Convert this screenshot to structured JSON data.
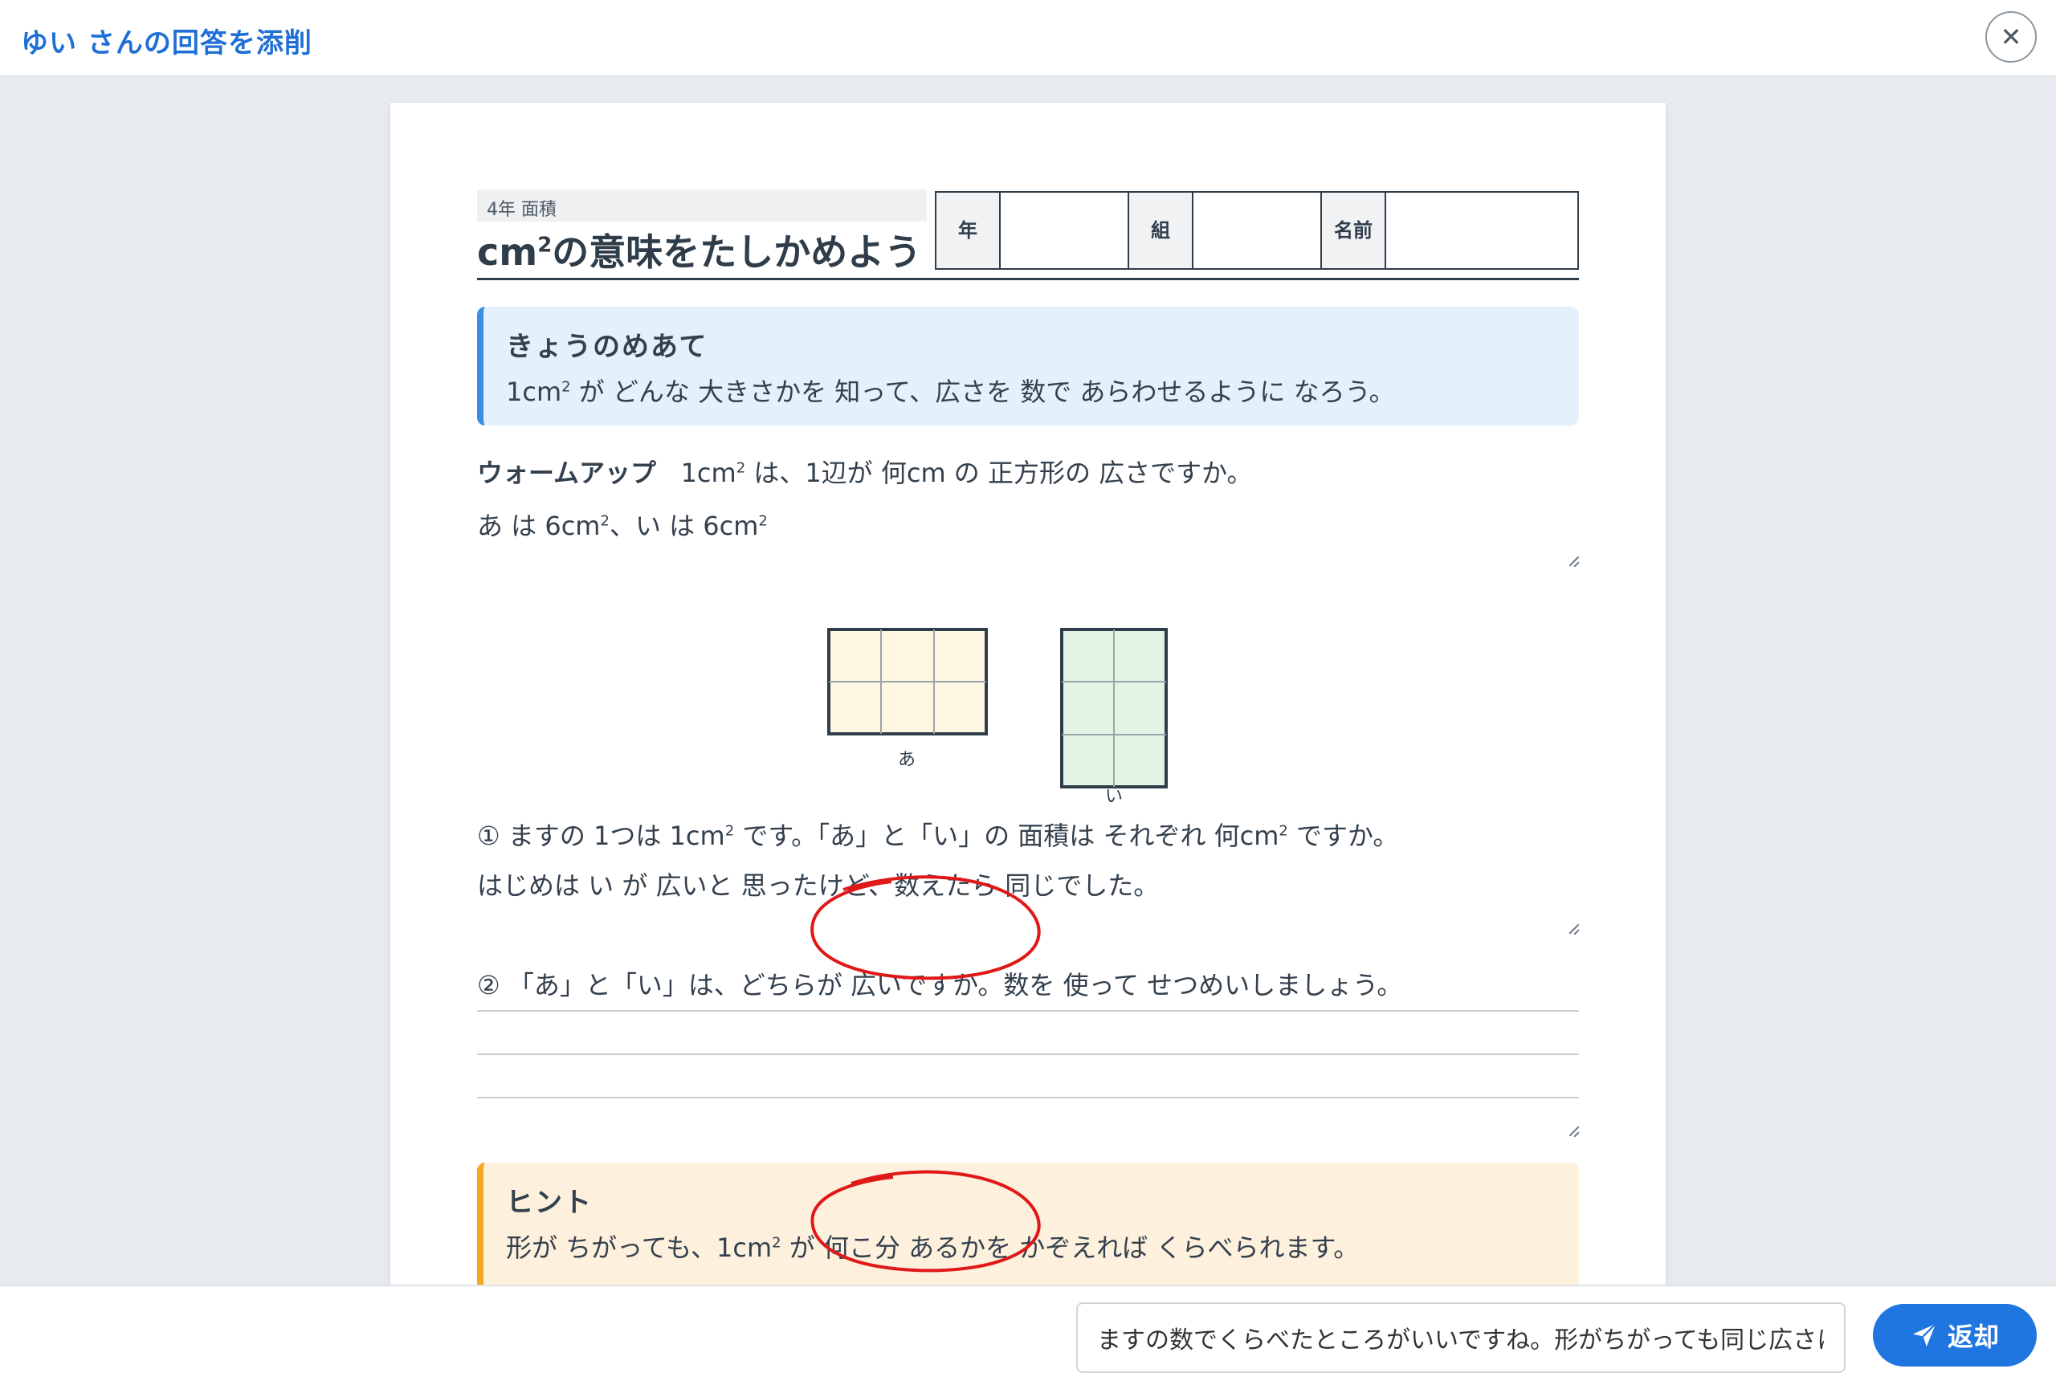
{
  "header": {
    "title": "ゆい さんの回答を添削",
    "close_icon": "close-icon"
  },
  "sheet": {
    "unit_tag": "4年 面積",
    "title_prefix": "cm",
    "title_sup": "2",
    "title_suffix": "の意味をたしかめよう",
    "name_table": {
      "year_label": "年",
      "class_label": "組",
      "name_label_1": "名",
      "name_label_2": "前"
    },
    "goal": {
      "heading": "きょうのめあて",
      "body_a": "1cm",
      "body_sup": "2",
      "body_b": " が どんな 大きさかを 知って、広さを 数で あらわせるように なろう。"
    },
    "warmup": {
      "label": "ウォームアップ",
      "question_a": "1cm",
      "question_sup": "2",
      "question_b": " は、1辺が 何cm の 正方形の 広さですか。",
      "answer_a": "あ は 6cm",
      "answer_sup1": "2",
      "answer_b": "、い は 6cm",
      "answer_sup2": "2"
    },
    "figures": {
      "label_a": "あ",
      "label_b": "い"
    },
    "q1": {
      "text_a": "① ますの 1つは 1cm",
      "sup1": "2",
      "text_b": " です。「あ」と「い」の 面積は それぞれ 何cm",
      "sup2": "2",
      "text_c": " ですか。",
      "answer": "はじめは い が 広いと 思ったけど、数えたら 同じでした。"
    },
    "q2": {
      "text": "② 「あ」と「い」は、どちらが 広いですか。数を 使って せつめいしましょう。"
    },
    "hint": {
      "heading": "ヒント",
      "body_a": "形が ちがっても、1cm",
      "body_sup": "2",
      "body_b": " が 何こ分 あるかを かぞえれば くらべられます。"
    }
  },
  "footer": {
    "comment_value": "ますの数でくらべたところがいいですね。形がちがっても同じ広さになることがわかりました",
    "return_label": "返却",
    "send_icon": "send-icon"
  },
  "colors": {
    "accent": "#1f76e0",
    "goal_bg": "#e4f1fc",
    "hint_bg": "#fdf0dc",
    "figure_a_fill": "#fdf6e1",
    "figure_b_fill": "#e4f4e4",
    "red_pen": "#e01818"
  }
}
